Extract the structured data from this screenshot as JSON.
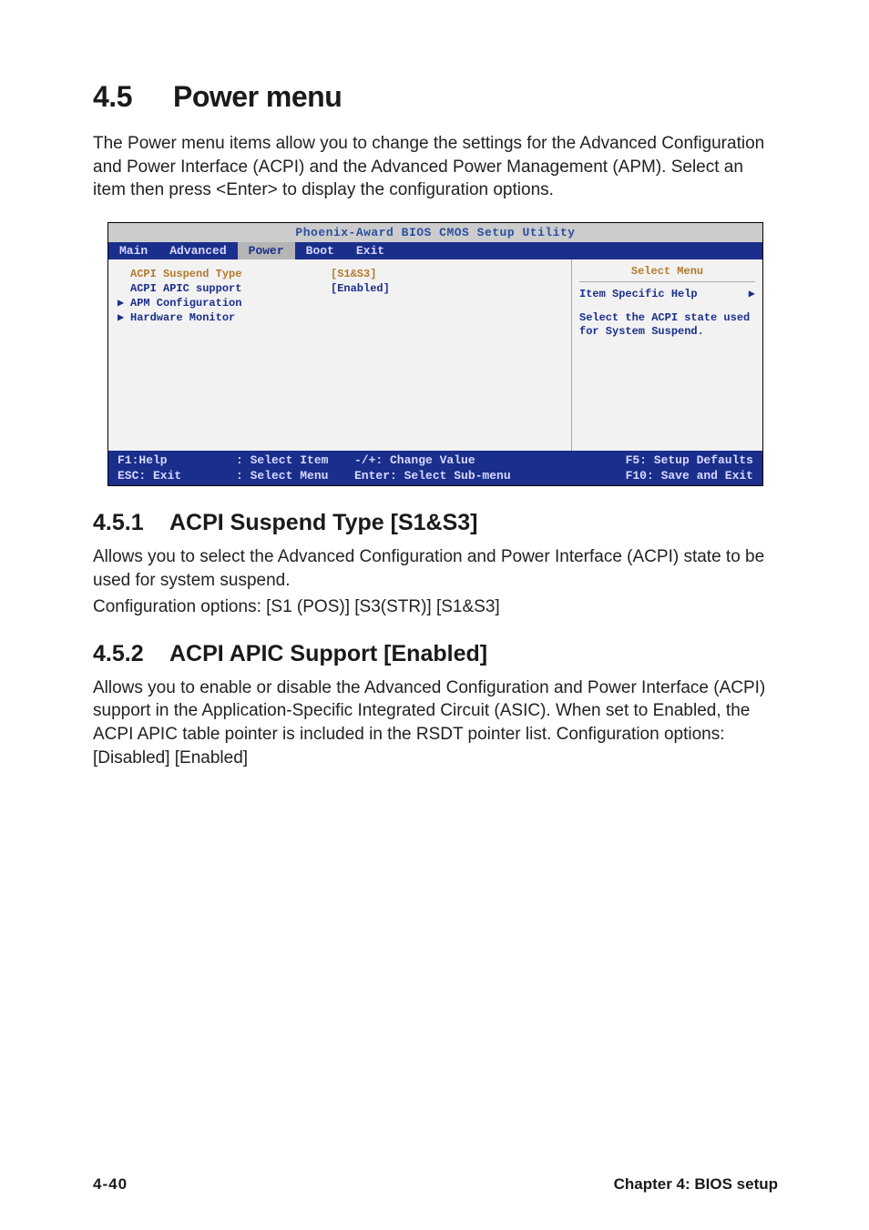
{
  "section": {
    "number": "4.5",
    "title": "Power menu",
    "intro": "The Power menu items allow you to change the settings for the Advanced Configuration and Power Interface (ACPI) and the Advanced Power Management (APM). Select an item then press <Enter> to display the configuration options."
  },
  "bios": {
    "title": "Phoenix-Award BIOS CMOS Setup Utility",
    "tabs": [
      "Main",
      "Advanced",
      "Power",
      "Boot",
      "Exit"
    ],
    "active_tab_index": 2,
    "rows": [
      {
        "mark": "",
        "label": "ACPI Suspend Type",
        "value": "[S1&S3]",
        "selected": true
      },
      {
        "mark": "",
        "label": "ACPI APIC support",
        "value": "[Enabled]",
        "selected": false
      },
      {
        "mark": "▶",
        "label": "APM Configuration",
        "value": "",
        "selected": false
      },
      {
        "mark": "▶",
        "label": "Hardware Monitor",
        "value": "",
        "selected": false
      }
    ],
    "help_title": "Select Menu",
    "help_label": "Item Specific Help",
    "help_arrow": "▶",
    "help_text": "Select the ACPI state used for System Suspend.",
    "footer": {
      "f1": "F1:Help",
      "esc": "ESC: Exit",
      "arrows": ": Select Item",
      "arrows2": ": Select Menu",
      "plus": "-/+: Change Value",
      "enter": "Enter: Select Sub-menu",
      "f5": "F5: Setup Defaults",
      "f10": "F10: Save and Exit"
    }
  },
  "sub1": {
    "number": "4.5.1",
    "title": "ACPI Suspend Type [S1&S3]",
    "p1": "Allows you to select the Advanced Configuration and Power Interface (ACPI) state to be used for system suspend.",
    "p2": "Configuration options: [S1 (POS)] [S3(STR)] [S1&S3]"
  },
  "sub2": {
    "number": "4.5.2",
    "title": "ACPI APIC Support [Enabled]",
    "p1": "Allows you to enable or disable the Advanced Configuration and Power Interface (ACPI) support in the Application-Specific Integrated Circuit (ASIC). When set to Enabled, the ACPI APIC table pointer is included in the RSDT pointer list. Configuration options: [Disabled] [Enabled]"
  },
  "footer": {
    "page": "4-40",
    "chapter": "Chapter 4: BIOS setup"
  }
}
